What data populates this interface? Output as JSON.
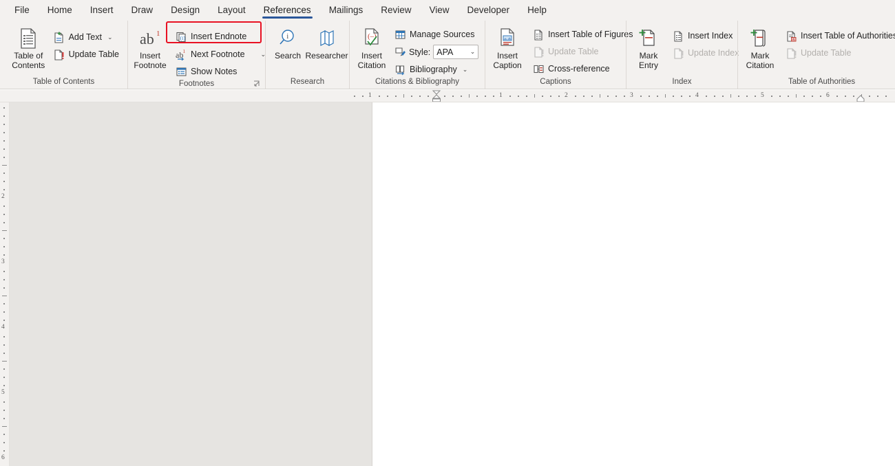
{
  "app": {
    "active_tab": "References"
  },
  "tabs": [
    {
      "label": "File"
    },
    {
      "label": "Home"
    },
    {
      "label": "Insert"
    },
    {
      "label": "Draw"
    },
    {
      "label": "Design"
    },
    {
      "label": "Layout"
    },
    {
      "label": "References"
    },
    {
      "label": "Mailings"
    },
    {
      "label": "Review"
    },
    {
      "label": "View"
    },
    {
      "label": "Developer"
    },
    {
      "label": "Help"
    }
  ],
  "groups": {
    "toc": {
      "label": "Table of Contents",
      "big": {
        "label": "Table of\nContents",
        "icon": "table-of-contents-icon",
        "has_caret": true
      },
      "items": [
        {
          "label": "Add Text",
          "icon": "add-text-icon",
          "has_caret": true,
          "disabled": false
        },
        {
          "label": "Update Table",
          "icon": "update-table-icon",
          "has_caret": false,
          "disabled": false
        }
      ]
    },
    "footnotes": {
      "label": "Footnotes",
      "big": {
        "label": "Insert\nFootnote",
        "icon": "insert-footnote-icon",
        "has_caret": false
      },
      "items": [
        {
          "label": "Insert Endnote",
          "icon": "insert-endnote-icon",
          "has_caret": false,
          "disabled": false
        },
        {
          "label": "Next Footnote",
          "icon": "next-footnote-icon",
          "has_caret": true,
          "disabled": false
        },
        {
          "label": "Show Notes",
          "icon": "show-notes-icon",
          "has_caret": false,
          "disabled": false
        }
      ],
      "has_launcher": true
    },
    "research": {
      "label": "Research",
      "buttons": [
        {
          "label": "Search",
          "icon": "search-icon"
        },
        {
          "label": "Researcher",
          "icon": "researcher-icon"
        }
      ]
    },
    "citations": {
      "label": "Citations & Bibliography",
      "big": {
        "label": "Insert\nCitation",
        "icon": "insert-citation-icon",
        "has_caret": true
      },
      "items": [
        {
          "label": "Manage Sources",
          "icon": "manage-sources-icon",
          "has_caret": false,
          "disabled": false
        },
        {
          "label": "Bibliography",
          "icon": "bibliography-icon",
          "has_caret": true,
          "disabled": false
        }
      ],
      "style": {
        "label": "Style:",
        "value": "APA",
        "icon": "style-icon"
      }
    },
    "captions": {
      "label": "Captions",
      "big": {
        "label": "Insert\nCaption",
        "icon": "insert-caption-icon",
        "has_caret": false
      },
      "items": [
        {
          "label": "Insert Table of Figures",
          "icon": "insert-table-of-figures-icon",
          "has_caret": false,
          "disabled": false
        },
        {
          "label": "Update Table",
          "icon": "update-table-icon",
          "has_caret": false,
          "disabled": true
        },
        {
          "label": "Cross-reference",
          "icon": "cross-reference-icon",
          "has_caret": false,
          "disabled": false
        }
      ]
    },
    "index": {
      "label": "Index",
      "big": {
        "label": "Mark\nEntry",
        "icon": "mark-entry-icon",
        "has_caret": false
      },
      "items": [
        {
          "label": "Insert Index",
          "icon": "insert-index-icon",
          "has_caret": false,
          "disabled": false
        },
        {
          "label": "Update Index",
          "icon": "update-index-icon",
          "has_caret": false,
          "disabled": true
        }
      ]
    },
    "authorities": {
      "label": "Table of Authorities",
      "big": {
        "label": "Mark\nCitation",
        "icon": "mark-citation-icon",
        "has_caret": false
      },
      "items": [
        {
          "label": "Insert Table of Authorities",
          "icon": "insert-table-of-authorities-icon",
          "has_caret": false,
          "disabled": false
        },
        {
          "label": "Update Table",
          "icon": "update-table-icon",
          "has_caret": false,
          "disabled": true
        }
      ]
    }
  },
  "highlight": {
    "target": "Insert Endnote",
    "color": "#e81123"
  },
  "rulers": {
    "horizontal": {
      "numbers": [
        "1",
        "2",
        "3",
        "4",
        "5",
        "6"
      ],
      "unit": "inch"
    },
    "vertical": {
      "numbers": [
        "2",
        "3",
        "4",
        "5",
        "6"
      ],
      "unit": "inch"
    }
  },
  "document": {
    "content": ""
  }
}
